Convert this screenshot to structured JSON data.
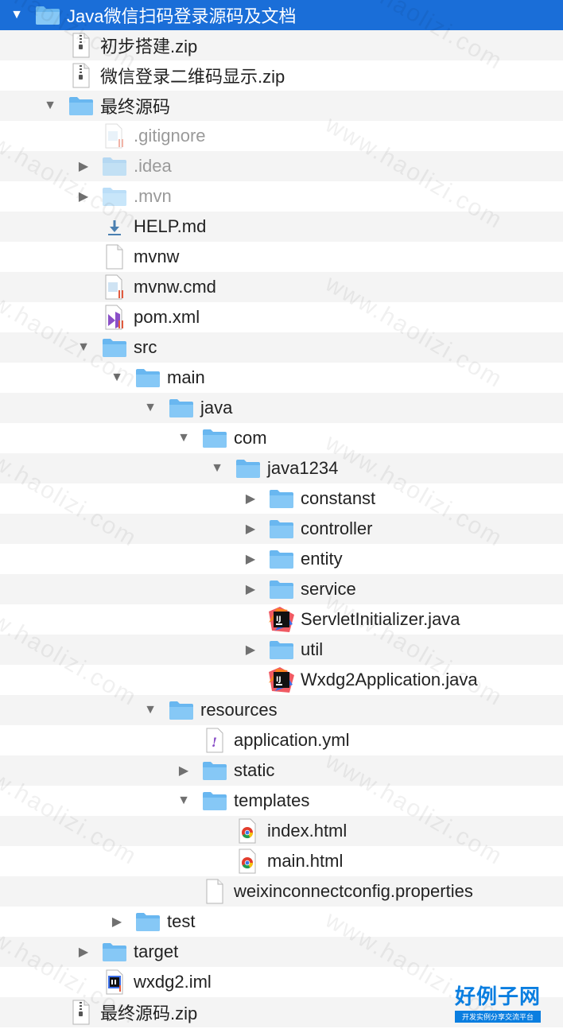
{
  "colors": {
    "selection": "#1a6ed8",
    "folder": "#69b7f0",
    "alt_row": "#f4f4f4",
    "brand": "#0a7ee0"
  },
  "watermark_text": "www.haolizi.com",
  "brand": {
    "name": "好例子网",
    "tagline": "开发实例分享交流平台"
  },
  "rows": [
    {
      "name": "Java微信扫码登录源码及文档",
      "depth": 0,
      "disclosure": "expanded",
      "icon": "folder-icon",
      "selected": true
    },
    {
      "name": "初步搭建.zip",
      "depth": 1,
      "disclosure": "none",
      "icon": "zip-icon"
    },
    {
      "name": "微信登录二维码显示.zip",
      "depth": 1,
      "disclosure": "none",
      "icon": "zip-icon"
    },
    {
      "name": "最终源码",
      "depth": 1,
      "disclosure": "expanded",
      "icon": "folder-icon"
    },
    {
      "name": ".gitignore",
      "depth": 2,
      "disclosure": "none",
      "icon": "text-file-icon",
      "dimmed": true
    },
    {
      "name": ".idea",
      "depth": 2,
      "disclosure": "collapsed",
      "icon": "folder-icon",
      "dimmed": true
    },
    {
      "name": ".mvn",
      "depth": 2,
      "disclosure": "collapsed",
      "icon": "folder-icon",
      "dimmed": true
    },
    {
      "name": "HELP.md",
      "depth": 2,
      "disclosure": "none",
      "icon": "markdown-file-icon"
    },
    {
      "name": "mvnw",
      "depth": 2,
      "disclosure": "none",
      "icon": "blank-file-icon"
    },
    {
      "name": "mvnw.cmd",
      "depth": 2,
      "disclosure": "none",
      "icon": "text-file-icon"
    },
    {
      "name": "pom.xml",
      "depth": 2,
      "disclosure": "none",
      "icon": "xml-file-icon"
    },
    {
      "name": "src",
      "depth": 2,
      "disclosure": "expanded",
      "icon": "folder-icon"
    },
    {
      "name": "main",
      "depth": 3,
      "disclosure": "expanded",
      "icon": "folder-icon"
    },
    {
      "name": "java",
      "depth": 4,
      "disclosure": "expanded",
      "icon": "folder-icon"
    },
    {
      "name": "com",
      "depth": 5,
      "disclosure": "expanded",
      "icon": "folder-icon"
    },
    {
      "name": "java1234",
      "depth": 6,
      "disclosure": "expanded",
      "icon": "folder-icon"
    },
    {
      "name": "constanst",
      "depth": 7,
      "disclosure": "collapsed",
      "icon": "folder-icon"
    },
    {
      "name": "controller",
      "depth": 7,
      "disclosure": "collapsed",
      "icon": "folder-icon"
    },
    {
      "name": "entity",
      "depth": 7,
      "disclosure": "collapsed",
      "icon": "folder-icon"
    },
    {
      "name": "service",
      "depth": 7,
      "disclosure": "collapsed",
      "icon": "folder-icon"
    },
    {
      "name": "ServletInitializer.java",
      "depth": 7,
      "disclosure": "none",
      "icon": "intellij-file-icon"
    },
    {
      "name": "util",
      "depth": 7,
      "disclosure": "collapsed",
      "icon": "folder-icon"
    },
    {
      "name": "Wxdg2Application.java",
      "depth": 7,
      "disclosure": "none",
      "icon": "intellij-file-icon"
    },
    {
      "name": "resources",
      "depth": 4,
      "disclosure": "expanded",
      "icon": "folder-icon"
    },
    {
      "name": "application.yml",
      "depth": 5,
      "disclosure": "none",
      "icon": "yml-file-icon"
    },
    {
      "name": "static",
      "depth": 5,
      "disclosure": "collapsed",
      "icon": "folder-icon"
    },
    {
      "name": "templates",
      "depth": 5,
      "disclosure": "expanded",
      "icon": "folder-icon"
    },
    {
      "name": "index.html",
      "depth": 6,
      "disclosure": "none",
      "icon": "chrome-html-icon"
    },
    {
      "name": "main.html",
      "depth": 6,
      "disclosure": "none",
      "icon": "chrome-html-icon"
    },
    {
      "name": "weixinconnectconfig.properties",
      "depth": 5,
      "disclosure": "none",
      "icon": "blank-file-icon"
    },
    {
      "name": "test",
      "depth": 3,
      "disclosure": "collapsed",
      "icon": "folder-icon"
    },
    {
      "name": "target",
      "depth": 2,
      "disclosure": "collapsed",
      "icon": "folder-icon"
    },
    {
      "name": "wxdg2.iml",
      "depth": 2,
      "disclosure": "none",
      "icon": "iml-file-icon"
    },
    {
      "name": "最终源码.zip",
      "depth": 1,
      "disclosure": "none",
      "icon": "zip-icon"
    }
  ]
}
